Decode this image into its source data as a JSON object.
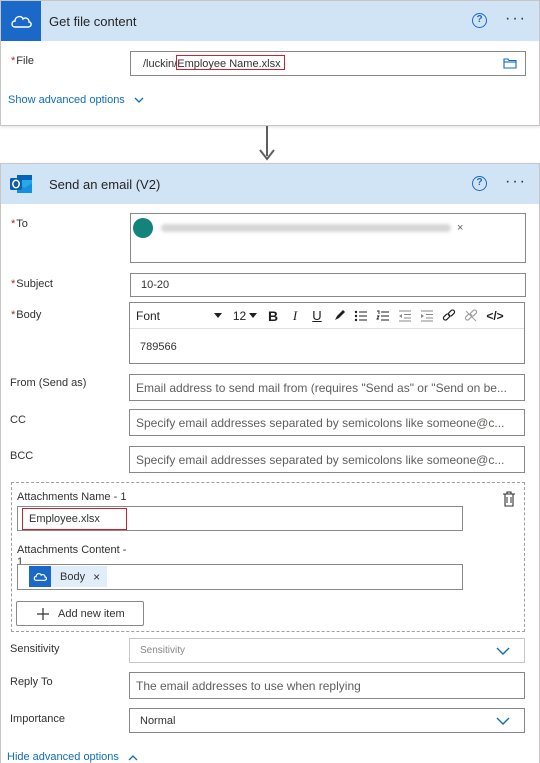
{
  "file_card": {
    "title": "Get file content",
    "help": "?",
    "more": "···",
    "file_label": "File",
    "file_path_prefix": "/luckin/",
    "file_path_name": "Employee Name.xlsx",
    "show_advanced": "Show advanced options"
  },
  "email_card": {
    "title": "Send an email (V2)",
    "help": "?",
    "more": "···",
    "to_label": "To",
    "to_chip_close": "×",
    "subject_label": "Subject",
    "subject_value": "10-20",
    "body_label": "Body",
    "body_toolbar": {
      "font": "Font",
      "size": "12",
      "bold": "B",
      "italic": "I",
      "underline": "U",
      "code": "</>"
    },
    "body_value": "789566",
    "from_label": "From (Send as)",
    "from_placeholder": "Email address to send mail from (requires \"Send as\" or \"Send on be...",
    "cc_label": "CC",
    "cc_placeholder": "Specify email addresses separated by semicolons like someone@c...",
    "bcc_label": "BCC",
    "bcc_placeholder": "Specify email addresses separated by semicolons like someone@c...",
    "attachments": {
      "name_label": "Attachments Name - 1",
      "name_value": "Employee.xlsx",
      "content_label": "Attachments Content -",
      "content_label_line2": "1",
      "content_chip": "Body",
      "content_chip_close": "×",
      "add_item": "Add new item"
    },
    "sensitivity_label": "Sensitivity",
    "sensitivity_value": "Sensitivity",
    "reply_to_label": "Reply To",
    "reply_to_placeholder": "The email addresses to use when replying",
    "importance_label": "Importance",
    "importance_value": "Normal",
    "hide_advanced": "Hide advanced options"
  },
  "colors": {
    "header_bg": "#d0e4f5",
    "link": "#0f6cbd",
    "required": "#a4262c",
    "highlight_box": "#d02030"
  }
}
